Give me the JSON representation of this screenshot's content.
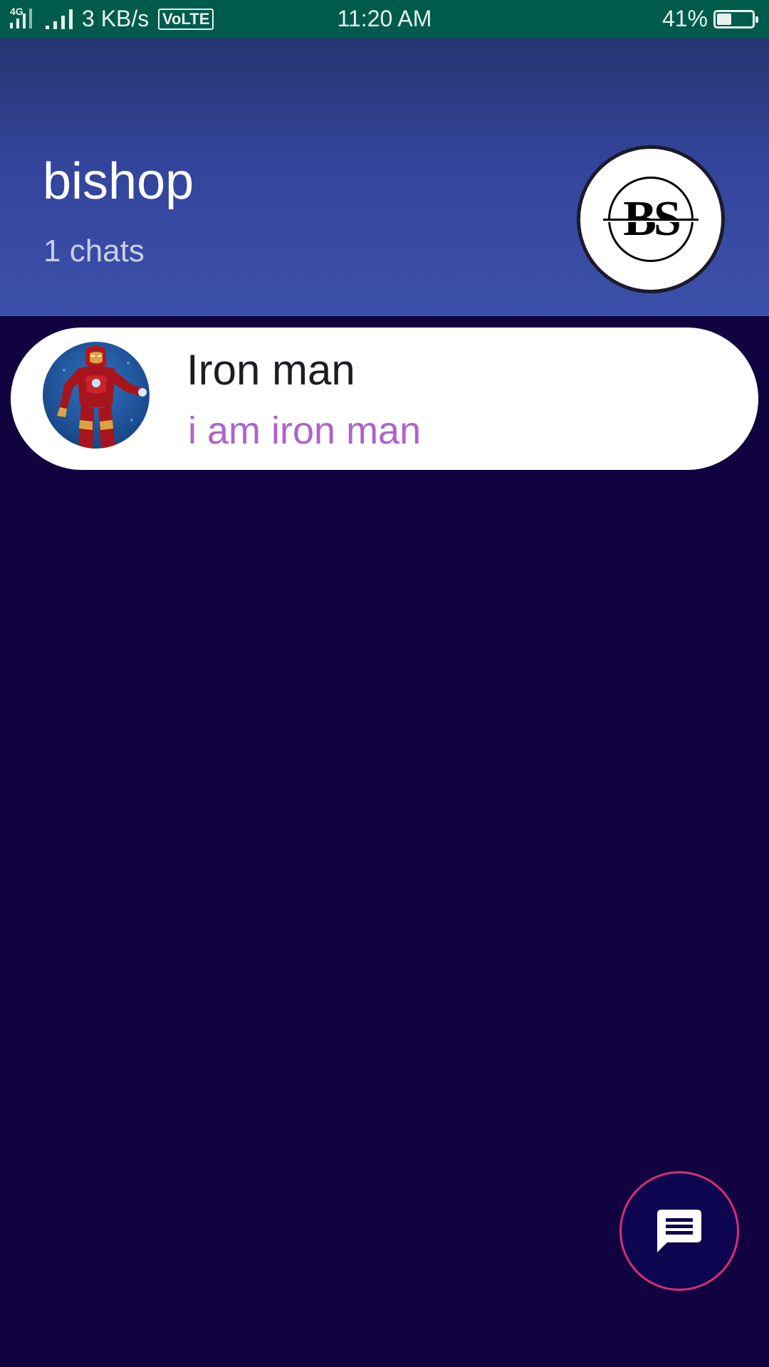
{
  "status_bar": {
    "network": "4G",
    "speed": "3 KB/s",
    "volte": "VoLTE",
    "time": "11:20 AM",
    "battery_pct_label": "41%",
    "battery_level": 0.41,
    "icons": [
      "signal-4g-icon",
      "signal-icon",
      "volte-icon",
      "battery-icon"
    ]
  },
  "header": {
    "title": "bishop",
    "subtitle": "1 chats",
    "profile_logo_text": "BS",
    "colors": {
      "gradient_top": "#263470",
      "gradient_bottom": "#3c51ab"
    }
  },
  "chats": [
    {
      "name": "Iron man",
      "last_message": "i am iron man",
      "avatar_icon": "iron-man-avatar"
    }
  ],
  "fab": {
    "icon": "chat-message-icon",
    "color": "#0d054f",
    "border_color": "#d52f72"
  },
  "colors": {
    "status_bar": "#005b4c",
    "background": "#11033f",
    "chat_card": "#ffffff",
    "last_message": "#ad63cc"
  }
}
